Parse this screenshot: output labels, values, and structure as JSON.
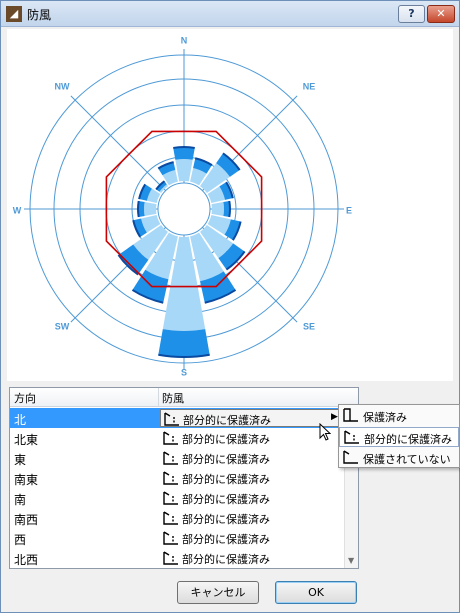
{
  "window": {
    "title": "防風",
    "help_label": "?",
    "close_label": "✕",
    "icon": "app-icon"
  },
  "compass": {
    "labels": [
      "N",
      "NE",
      "E",
      "SE",
      "S",
      "SW",
      "W",
      "NW"
    ],
    "colors": {
      "grid": "#4f9ad6",
      "full": "#1e90e8",
      "partial": "#a8d8f8",
      "outline": "#cc0000",
      "edge": "#0a4aa0"
    }
  },
  "list": {
    "headers": {
      "direction": "方向",
      "protection": "防風"
    },
    "rows": [
      {
        "direction": "北",
        "protection": "部分的に保護済み",
        "selected": true
      },
      {
        "direction": "北東",
        "protection": "部分的に保護済み"
      },
      {
        "direction": "東",
        "protection": "部分的に保護済み"
      },
      {
        "direction": "南東",
        "protection": "部分的に保護済み"
      },
      {
        "direction": "南",
        "protection": "部分的に保護済み"
      },
      {
        "direction": "南西",
        "protection": "部分的に保護済み"
      },
      {
        "direction": "西",
        "protection": "部分的に保護済み"
      },
      {
        "direction": "北西",
        "protection": "部分的に保護済み"
      }
    ]
  },
  "popup": {
    "items": [
      {
        "label": "保護済み",
        "icon": "protected-icon"
      },
      {
        "label": "部分的に保護済み",
        "icon": "partially-protected-icon",
        "active": true
      },
      {
        "label": "保護されていない",
        "icon": "unprotected-icon"
      }
    ]
  },
  "buttons": {
    "cancel": "キャンセル",
    "ok": "OK"
  }
}
